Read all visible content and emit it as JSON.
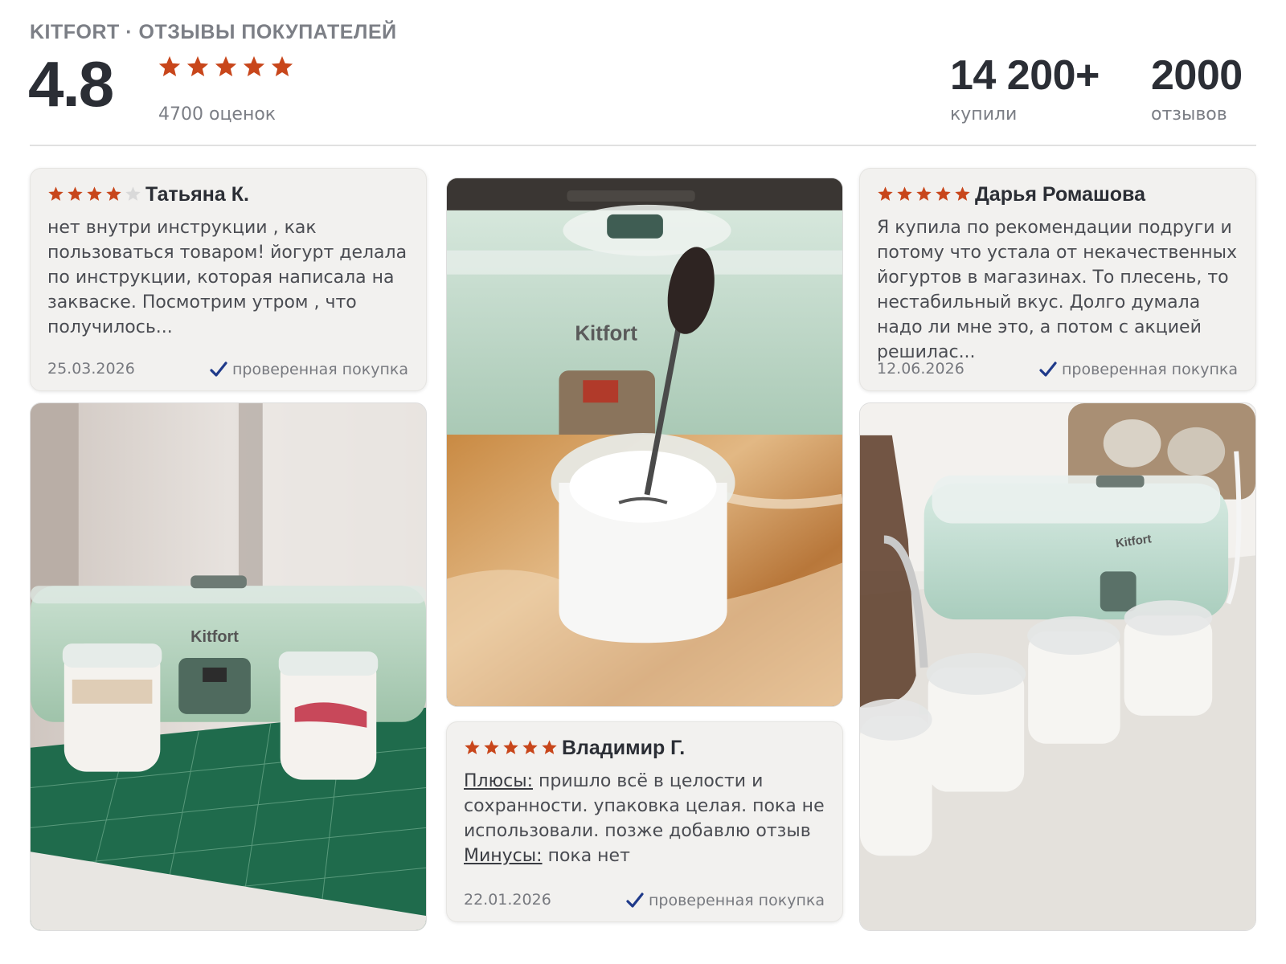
{
  "header": {
    "brand": "KITFORT · ОТЗЫВЫ ПОКУПАТЕЛЕЙ",
    "rating": "4.8",
    "rating_count": "4700 оценок",
    "stats": {
      "bought_value": "14 200+",
      "bought_label": "купили",
      "reviews_value": "2000",
      "reviews_label": "отзывов"
    }
  },
  "colors": {
    "star": "#c8461b",
    "star_empty": "#d9d9d9",
    "check": "#1f3a8a"
  },
  "reviews": [
    {
      "stars": 4,
      "author": "Татьяна К.",
      "text": "нет внутри инструкции , как пользоваться товаром! йогурт делала по инструкции, которая написала на закваске. Посмотрим утром , что получилось...",
      "date": "25.03.2026",
      "verified": "проверенная покупка"
    },
    {
      "stars": 5,
      "author": "Дарья Ромашова",
      "text": "Я купила по рекомендации подруги и потому что устала от некачественных йогуртов в магазинах. То плесень, то нестабильный вкус. Долго думала надо ли мне это, а потом с акцией решилас...",
      "date": "12.06.2026",
      "verified": "проверенная покупка"
    },
    {
      "stars": 5,
      "author": "Владимир Г.",
      "pros_label": "Плюсы:",
      "pros_text": "пришло всё в целости и сохранности. упаковка целая. пока не использовали. позже добавлю отзыв",
      "cons_label": "Минусы:",
      "cons_text": "пока нет",
      "date": "22.01.2026",
      "verified": "проверенная покупка"
    }
  ],
  "photos": {
    "kitfort_label": "Kitfort"
  }
}
